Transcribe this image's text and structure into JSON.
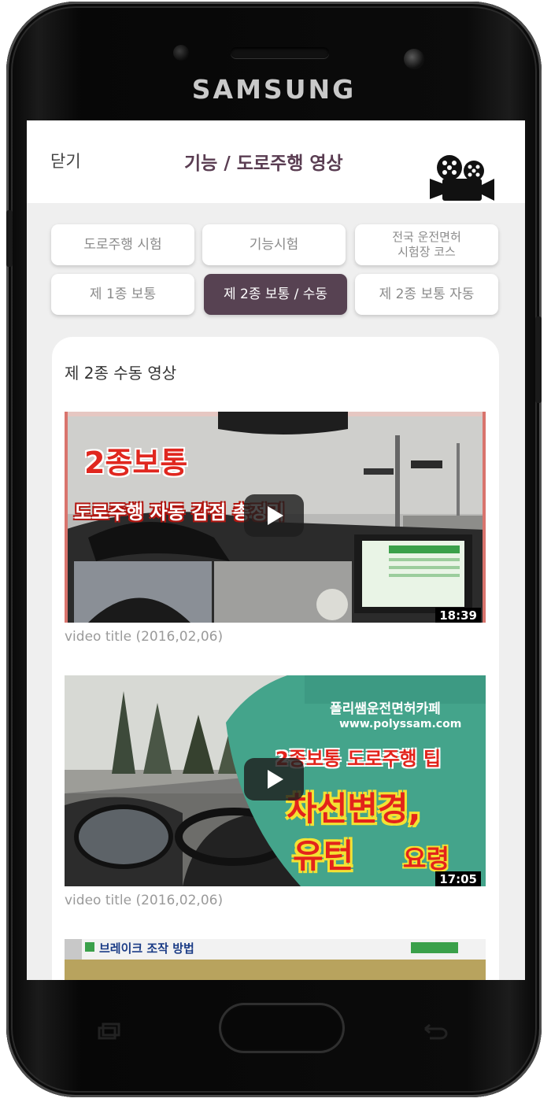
{
  "device": {
    "brand": "SAMSUNG"
  },
  "header": {
    "close_label": "닫기",
    "title": "기능 / 도로주행 영상",
    "icon": "movie-camera-icon"
  },
  "tabs": [
    {
      "label": "도로주행 시험",
      "active": false
    },
    {
      "label": "기능시험",
      "active": false
    },
    {
      "label": "전국 운전면허\n시험장 코스",
      "active": false
    },
    {
      "label": "제 1종 보통",
      "active": false
    },
    {
      "label": "제 2종 보통 / 수동",
      "active": true
    },
    {
      "label": "제 2종 보통 자동",
      "active": false
    }
  ],
  "section": {
    "title": "제 2종 수동 영상",
    "videos": [
      {
        "caption": "video title (2016,02,06)",
        "duration": "18:39",
        "overlay_big": "2종보통",
        "overlay_sub": "도로주행 자동 감점 총정리"
      },
      {
        "caption": "video title (2016,02,06)",
        "duration": "17:05",
        "overlay_brand": "폴리쌤운전면허카페",
        "overlay_url": "www.polyssam.com",
        "overlay_line1": "2종보통 도로주행 팁",
        "overlay_line2": "차선변경,",
        "overlay_line3a": "유턴",
        "overlay_line3b": "요령"
      },
      {
        "overlay_tag": "브레이크 조작 방법"
      }
    ]
  },
  "colors": {
    "accent": "#574252",
    "title": "#5a3d52",
    "caption": "#9a9a9a",
    "background": "#efefef"
  }
}
